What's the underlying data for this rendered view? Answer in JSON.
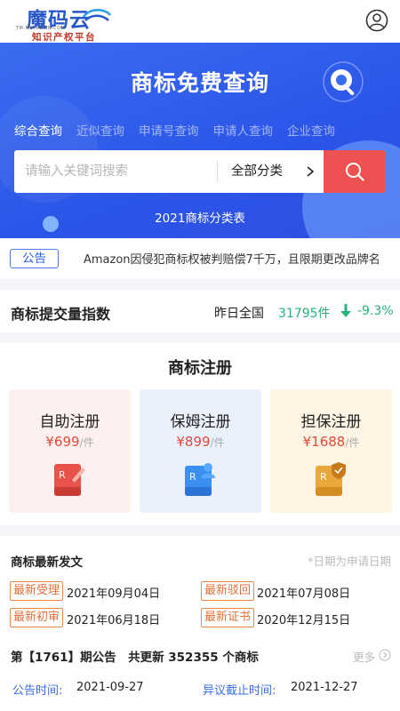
{
  "header": {
    "logo_name": "魔码云",
    "logo_url": "TM.MOMAYUN.COM",
    "logo_tagline": "知识产权平台"
  },
  "hero": {
    "title": "商标免费查询",
    "tabs": [
      "综合查询",
      "近似查询",
      "申请号查询",
      "申请人查询",
      "企业查询"
    ],
    "active_tab": "综合查询",
    "search_placeholder": "请输入关键词搜索",
    "category": "全部分类",
    "class_table_link": "2021商标分类表"
  },
  "notice": {
    "badge": "公告",
    "text": "Amazon因侵犯商标权被判赔偿7千万，且限期更改品牌名"
  },
  "index": {
    "title": "商标提交量指数",
    "label": "昨日全国",
    "value": "31795件",
    "change": "-9.3%",
    "trend": "down"
  },
  "register": {
    "title": "商标注册",
    "cards": [
      {
        "name": "自助注册",
        "price": "¥699",
        "unit": "/件",
        "icon": "self-register-icon"
      },
      {
        "name": "保姆注册",
        "price": "¥899",
        "unit": "/件",
        "icon": "nanny-register-icon"
      },
      {
        "name": "担保注册",
        "price": "¥1688",
        "unit": "/件",
        "icon": "guarantee-register-icon"
      }
    ]
  },
  "latest": {
    "title": "商标最新发文",
    "note": "*日期为申请日期",
    "items": [
      {
        "tag": "最新受理",
        "date": "2021年09月04日"
      },
      {
        "tag": "最新驳回",
        "date": "2021年07月08日"
      },
      {
        "tag": "最新初审",
        "date": "2021年06月18日"
      },
      {
        "tag": "最新证书",
        "date": "2020年12月15日"
      }
    ],
    "issue": "第【1761】期公告　共更新 352355 个商标",
    "more": "更多",
    "announce_label": "公告时间:",
    "announce_date": "2021-09-27",
    "objection_label": "异议截止时间:",
    "objection_date": "2021-12-27"
  },
  "colors": {
    "brand_blue": "#2b55e8",
    "search_red": "#ee5151",
    "up_green": "#27b37a",
    "tag_orange": "#e0703a"
  }
}
